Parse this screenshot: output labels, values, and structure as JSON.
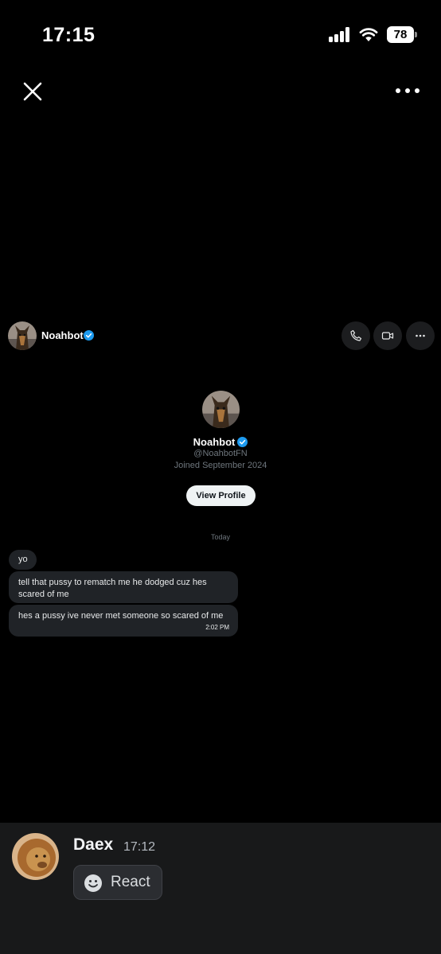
{
  "status_bar": {
    "time": "17:15",
    "battery": "78"
  },
  "viewer": {
    "close_icon": "close-icon",
    "more_icon": "more-horizontal-icon"
  },
  "chat": {
    "name": "Noahbot",
    "verified_color": "#1d9bf0",
    "actions": [
      "phone-icon",
      "video-icon",
      "more-icon"
    ]
  },
  "profile": {
    "name": "Noahbot",
    "handle": "@NoahbotFN",
    "joined": "Joined September 2024",
    "button": "View Profile"
  },
  "day_separator": "Today",
  "messages": [
    {
      "text": "yo"
    },
    {
      "text": "tell that pussy to rematch me he dodged cuz hes scared of me"
    },
    {
      "text": "hes a pussy ive never met someone so scared of me",
      "time": "2:02 PM"
    }
  ],
  "discord": {
    "username": "Daex",
    "timestamp": "17:12",
    "react_label": "React"
  }
}
